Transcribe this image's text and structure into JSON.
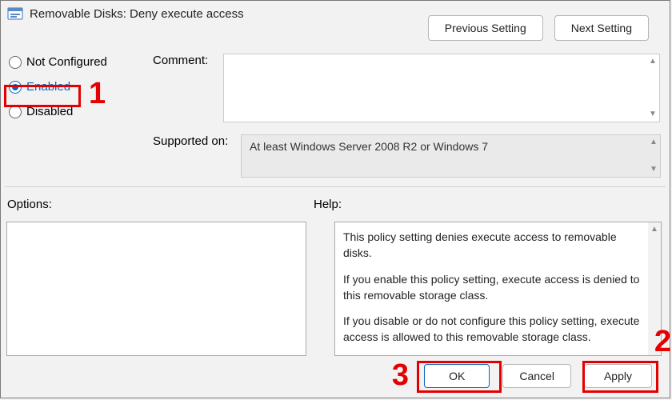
{
  "title": "Removable Disks: Deny execute access",
  "nav": {
    "prev": "Previous Setting",
    "next": "Next Setting"
  },
  "radios": {
    "not_configured": "Not Configured",
    "enabled": "Enabled",
    "disabled": "Disabled",
    "selected": "enabled"
  },
  "labels": {
    "comment": "Comment:",
    "supported": "Supported on:",
    "options": "Options:",
    "help": "Help:"
  },
  "comment_value": "",
  "supported_value": "At least Windows Server 2008 R2 or Windows 7",
  "help": {
    "p1": "This policy setting denies execute access to removable disks.",
    "p2": "If you enable this policy setting, execute access is denied to this removable storage class.",
    "p3": "If you disable or do not configure this policy setting, execute access is allowed to this removable storage class."
  },
  "buttons": {
    "ok": "OK",
    "cancel": "Cancel",
    "apply": "Apply"
  },
  "annotations": {
    "a1": "1",
    "a2": "2",
    "a3": "3"
  }
}
